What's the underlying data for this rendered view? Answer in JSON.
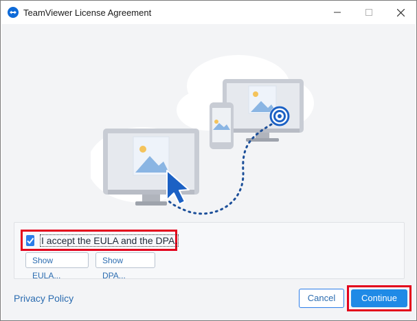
{
  "window": {
    "title": "TeamViewer License Agreement"
  },
  "options": {
    "accept_label": "I accept the EULA and the DPA.",
    "accept_checked": true,
    "show_eula_label": "Show EULA...",
    "show_dpa_label": "Show DPA..."
  },
  "footer": {
    "privacy_label": "Privacy Policy",
    "cancel_label": "Cancel",
    "continue_label": "Continue"
  },
  "colors": {
    "accent": "#1f8ae6",
    "highlight": "#e3001b",
    "link": "#2b6cb0"
  },
  "icons": [
    "teamviewer-logo-icon",
    "minimize-icon",
    "maximize-icon",
    "close-icon",
    "checkmark-icon"
  ]
}
